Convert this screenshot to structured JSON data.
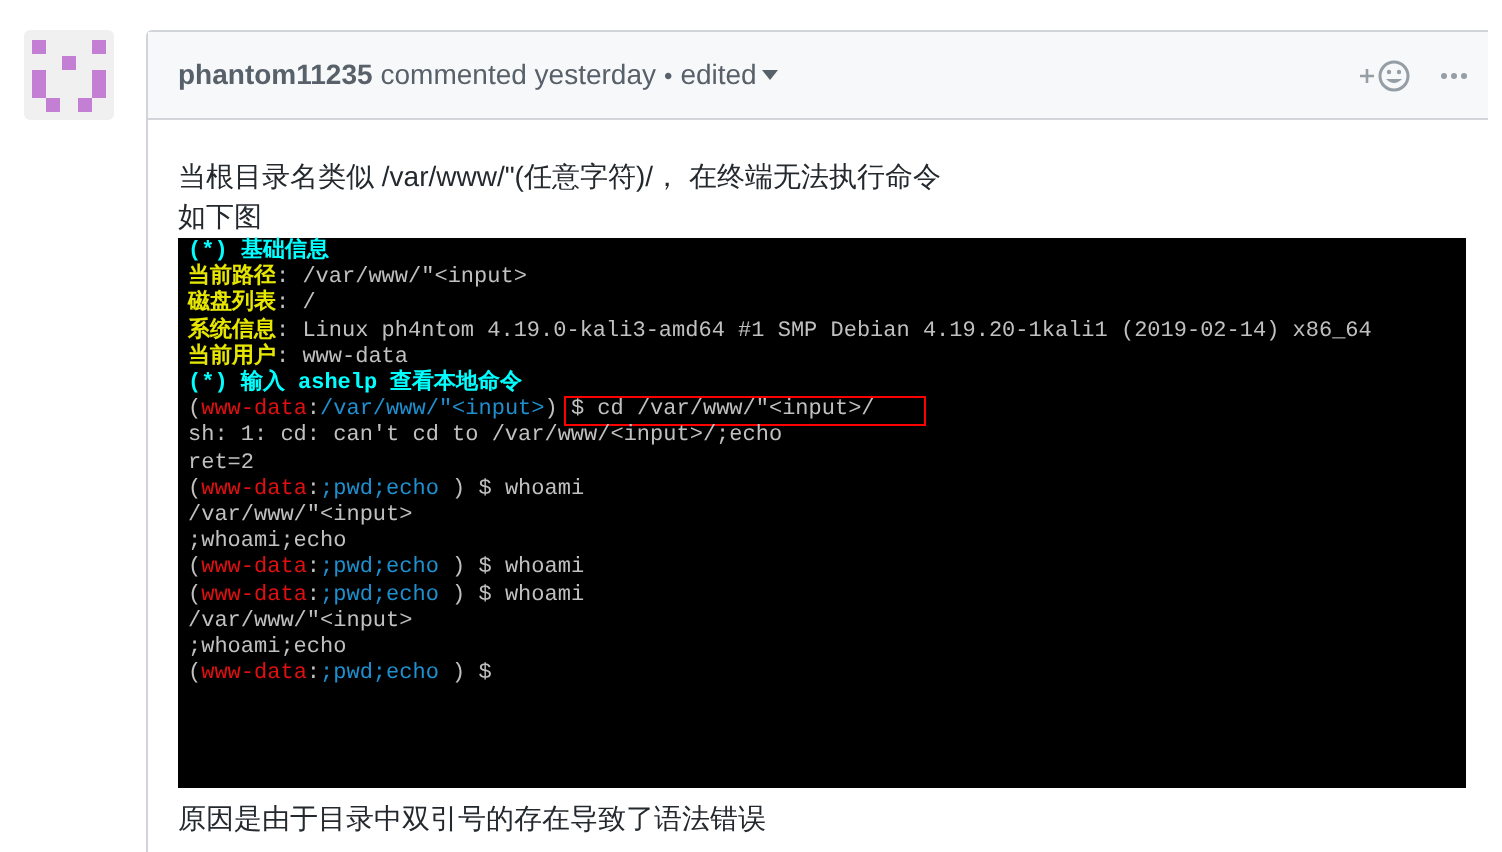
{
  "comment": {
    "author": "phantom11235",
    "action": "commented yesterday",
    "separator": "•",
    "edited": "edited",
    "body": [
      {
        "kind": "text",
        "text": "当根目录名类似 /var/www/\"(任意字符)/， 在终端无法执行命令"
      },
      {
        "kind": "text",
        "text": "如下图"
      },
      {
        "kind": "terminal",
        "lines": [
          [
            {
              "kind": "heading",
              "text": "(*) 基础信息"
            }
          ],
          [
            {
              "kind": "label",
              "text": "当前路径"
            },
            {
              "kind": "plain",
              "text": ": /var/www/\"<input>"
            }
          ],
          [
            {
              "kind": "label",
              "text": "磁盘列表"
            },
            {
              "kind": "plain",
              "text": ": /"
            }
          ],
          [
            {
              "kind": "label",
              "text": "系统信息"
            },
            {
              "kind": "plain",
              "text": ": Linux ph4ntom 4.19.0-kali3-amd64 #1 SMP Debian 4.19.20-1kali1 (2019-02-14) x86_64"
            }
          ],
          [
            {
              "kind": "label",
              "text": "当前用户"
            },
            {
              "kind": "plain",
              "text": ": www-data"
            }
          ],
          [
            {
              "kind": "heading",
              "text": "(*) 输入 ashelp 查看本地命令"
            }
          ],
          [
            {
              "kind": "plain",
              "text": "("
            },
            {
              "kind": "user",
              "text": "www-data"
            },
            {
              "kind": "plain",
              "text": ":"
            },
            {
              "kind": "path",
              "text": "/var/www/\"<input>"
            },
            {
              "kind": "plain",
              "text": ") "
            },
            {
              "kind": "plain",
              "text": "$ cd /var/www/\"<input>/",
              "highlighted": true
            }
          ],
          [
            {
              "kind": "plain",
              "text": "sh: 1: cd: can't cd to /var/www/<input>/;echo"
            }
          ],
          [
            {
              "kind": "plain",
              "text": "ret=2"
            }
          ],
          [
            {
              "kind": "plain",
              "text": "("
            },
            {
              "kind": "user",
              "text": "www-data"
            },
            {
              "kind": "plain",
              "text": ":"
            },
            {
              "kind": "path",
              "text": ";pwd;echo"
            },
            {
              "kind": "plain",
              "text": " ) $ whoami"
            }
          ],
          [
            {
              "kind": "plain",
              "text": "/var/www/\"<input>"
            }
          ],
          [
            {
              "kind": "plain",
              "text": ";whoami;echo"
            }
          ],
          [
            {
              "kind": "plain",
              "text": "("
            },
            {
              "kind": "user",
              "text": "www-data"
            },
            {
              "kind": "plain",
              "text": ":"
            },
            {
              "kind": "path",
              "text": ";pwd;echo"
            },
            {
              "kind": "plain",
              "text": " ) $ whoami"
            }
          ],
          [
            {
              "kind": "plain",
              "text": "("
            },
            {
              "kind": "user",
              "text": "www-data"
            },
            {
              "kind": "plain",
              "text": ":"
            },
            {
              "kind": "path",
              "text": ";pwd;echo"
            },
            {
              "kind": "plain",
              "text": " ) $ whoami"
            }
          ],
          [
            {
              "kind": "plain",
              "text": "/var/www/\"<input>"
            }
          ],
          [
            {
              "kind": "plain",
              "text": ";whoami;echo"
            }
          ],
          [
            {
              "kind": "plain",
              "text": "("
            },
            {
              "kind": "user",
              "text": "www-data"
            },
            {
              "kind": "plain",
              "text": ":"
            },
            {
              "kind": "path",
              "text": ";pwd;echo"
            },
            {
              "kind": "plain",
              "text": " ) $"
            }
          ]
        ]
      },
      {
        "kind": "text",
        "text": "原因是由于目录中双引号的存在导致了语法错误"
      }
    ]
  }
}
